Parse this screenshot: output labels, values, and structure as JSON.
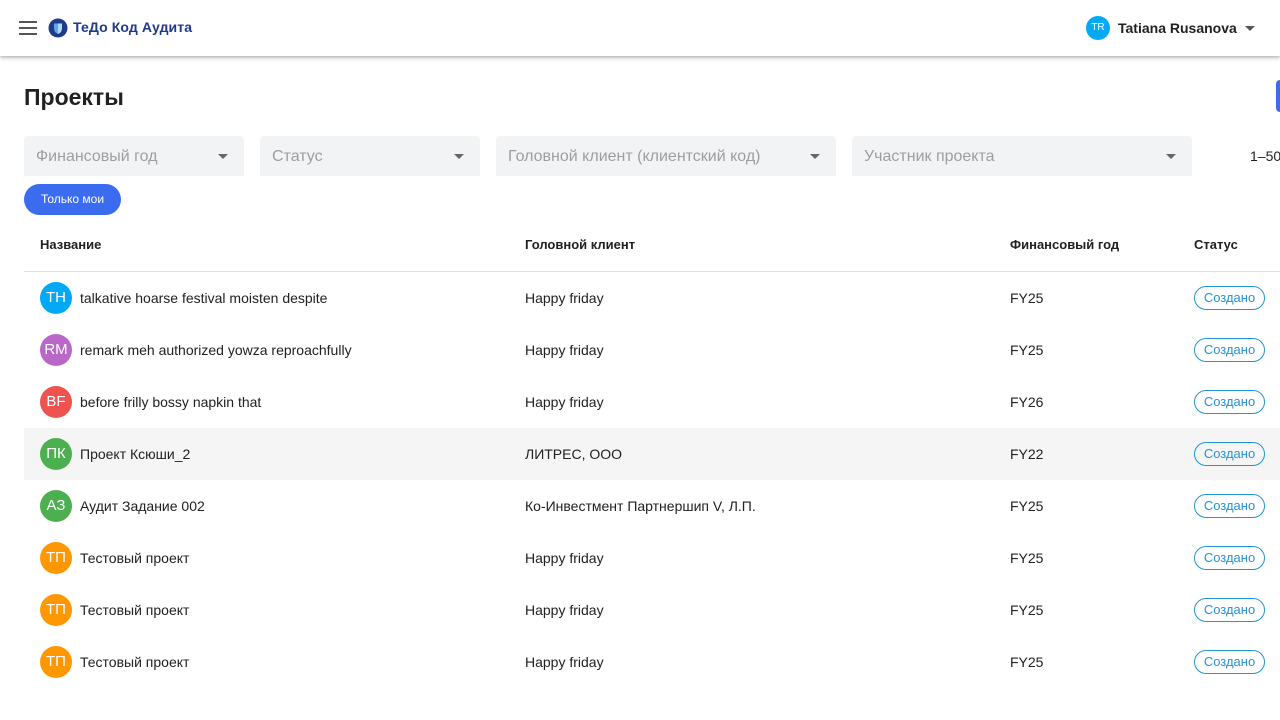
{
  "colors": {
    "brand": "#1e3a8a",
    "accent": "#3b6cf0",
    "badge": "#2196d3",
    "user_avatar": "#03a9f4"
  },
  "appbar": {
    "title": "ТеДо Код Аудита",
    "user": {
      "initials": "TR",
      "name": "Tatiana Rusanova"
    }
  },
  "page": {
    "title": "Проекты"
  },
  "filters": [
    {
      "placeholder": "Финансовый год"
    },
    {
      "placeholder": "Статус"
    },
    {
      "placeholder": "Головной клиент (клиентский код)"
    },
    {
      "placeholder": "Участник проекта"
    }
  ],
  "pager": {
    "text": "1–50"
  },
  "chip": {
    "label": "Только мои"
  },
  "table": {
    "columns": [
      "Название",
      "Головной клиент",
      "Финансовый год",
      "Статус"
    ],
    "rows": [
      {
        "initials": "TH",
        "color": "#03a9f4",
        "name": "talkative hoarse festival moisten despite",
        "client": "Happy friday",
        "fy": "FY25",
        "status": "Создано"
      },
      {
        "initials": "RM",
        "color": "#ba68c8",
        "name": "remark meh authorized yowza reproachfully",
        "client": "Happy friday",
        "fy": "FY25",
        "status": "Создано"
      },
      {
        "initials": "BF",
        "color": "#ef5350",
        "name": "before frilly bossy napkin that",
        "client": "Happy friday",
        "fy": "FY26",
        "status": "Создано"
      },
      {
        "initials": "ПК",
        "color": "#4caf50",
        "name": "Проект Ксюши_2",
        "client": "ЛИТРЕС, ООО",
        "fy": "FY22",
        "status": "Создано"
      },
      {
        "initials": "АЗ",
        "color": "#4caf50",
        "name": "Аудит Задание 002",
        "client": "Ко-Инвестмент Партнершип V, Л.П.",
        "fy": "FY25",
        "status": "Создано"
      },
      {
        "initials": "ТП",
        "color": "#ff9800",
        "name": "Тестовый проект",
        "client": "Happy friday",
        "fy": "FY25",
        "status": "Создано"
      },
      {
        "initials": "ТП",
        "color": "#ff9800",
        "name": "Тестовый проект",
        "client": "Happy friday",
        "fy": "FY25",
        "status": "Создано"
      },
      {
        "initials": "ТП",
        "color": "#ff9800",
        "name": "Тестовый проект",
        "client": "Happy friday",
        "fy": "FY25",
        "status": "Создано"
      }
    ]
  }
}
